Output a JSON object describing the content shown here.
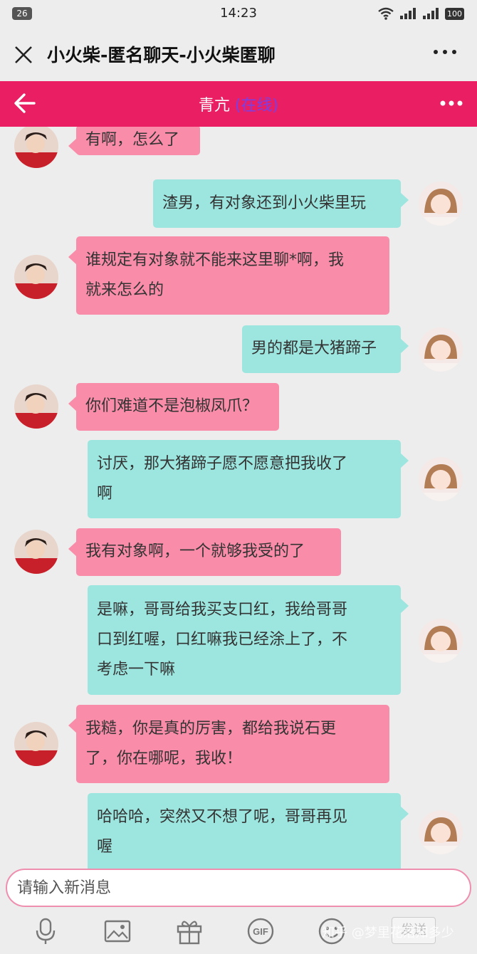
{
  "status_bar": {
    "notification_count": "26",
    "time": "14:23",
    "battery": "100"
  },
  "title_bar": {
    "title": "小火柴-匿名聊天-小火柴匿聊"
  },
  "chat_header": {
    "contact_name": "青亢",
    "contact_status": "(在线)",
    "accent_color": "#e91e63"
  },
  "messages": [
    {
      "side": "left",
      "lines": [
        "有啊，怎么了"
      ]
    },
    {
      "side": "right",
      "lines": [
        "渣男，有对象还到小火柴里玩"
      ]
    },
    {
      "side": "left",
      "lines": [
        "谁规定有对象就不能来这里聊*啊，我",
        "就来怎么的"
      ]
    },
    {
      "side": "right",
      "lines": [
        "男的都是大猪蹄子"
      ]
    },
    {
      "side": "left",
      "lines": [
        "你们难道不是泡椒凤爪？"
      ]
    },
    {
      "side": "right",
      "lines": [
        "讨厌，那大猪蹄子愿不愿意把我收了",
        "啊"
      ]
    },
    {
      "side": "left",
      "lines": [
        "我有对象啊，一个就够我受的了"
      ]
    },
    {
      "side": "right",
      "lines": [
        "是嘛，哥哥给我买支口红，我给哥哥",
        "口到红喔，口红嘛我已经涂上了，不",
        "考虑一下嘛"
      ]
    },
    {
      "side": "left",
      "lines": [
        "我糙，你是真的厉害，都给我说石更",
        "了，你在哪呢，我收！"
      ]
    },
    {
      "side": "right",
      "lines": [
        "哈哈哈，突然又不想了呢，哥哥再见",
        "喔"
      ]
    }
  ],
  "input": {
    "placeholder": "请输入新消息",
    "value": ""
  },
  "toolbar": {
    "icons": [
      "microphone-icon",
      "image-icon",
      "gift-icon",
      "gif-icon",
      "emoji-icon"
    ],
    "send_label": "发送"
  },
  "watermark": "知乎 @梦里花落知多少"
}
